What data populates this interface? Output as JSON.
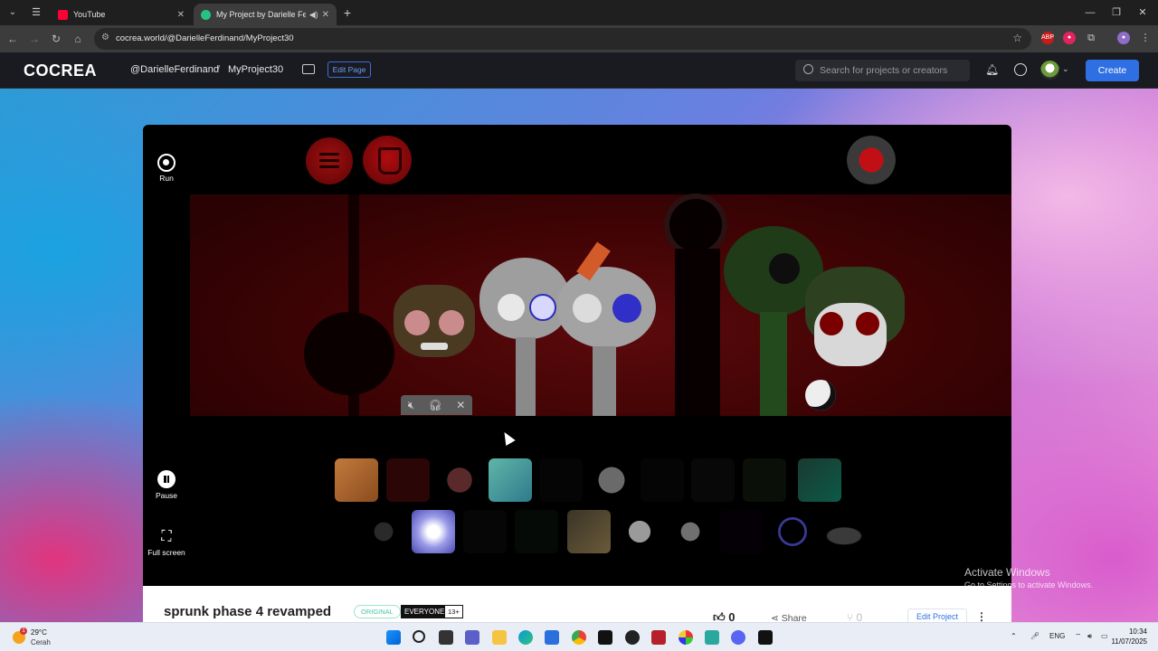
{
  "browser": {
    "tabs": [
      {
        "title": "YouTube",
        "active": false
      },
      {
        "title": "My Project by Darielle Ferd",
        "active": true
      }
    ],
    "url": "cocrea.world/@DarielleFerdinand/MyProject30"
  },
  "header": {
    "logo": "COCREA",
    "owner": "@DarielleFerdinand",
    "separator": "/",
    "project": "MyProject30",
    "edit_page": "Edit Page",
    "search_placeholder": "Search for projects or creators",
    "create": "Create"
  },
  "player": {
    "run_label": "Run",
    "pause_label": "Pause",
    "fullscreen_label": "Full screen"
  },
  "project": {
    "title": "sprunk phase 4 revamped",
    "badge_original": "ORIGINAL",
    "rating": "EVERYONE",
    "age": "13+",
    "likes": "0",
    "share": "Share",
    "forks": "0",
    "edit_project": "Edit Project"
  },
  "watermark": {
    "line1": "Activate Windows",
    "line2": "Go to Settings to activate Windows."
  },
  "taskbar": {
    "temp": "29°C",
    "weather": "Cerah",
    "lang": "ENG",
    "time": "10:34",
    "date": "11/07/2025"
  },
  "colors": {
    "accent": "#2f6fe4",
    "stage_red": "#3e0304"
  }
}
